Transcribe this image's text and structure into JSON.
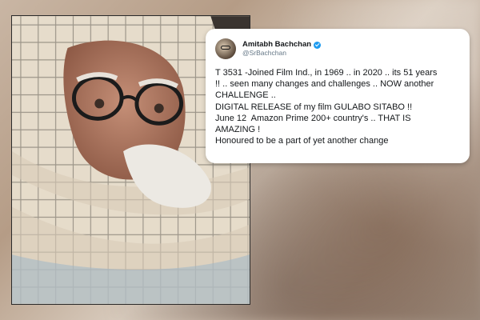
{
  "tweet": {
    "display_name": "Amitabh Bachchan",
    "handle": "@SrBachchan",
    "verified": true,
    "lines": [
      "T 3531 -Joined Film Ind., in 1969 .. in 2020 .. its 51 years",
      "!! .. seen many changes and challenges .. NOW another",
      "CHALLENGE ..",
      "DIGITAL RELEASE of my film GULABO SITABO !!",
      "June 12  Amazon Prime 200+ country's .. THAT IS",
      "AMAZING !",
      "Honoured to be a part of yet another change"
    ]
  },
  "colors": {
    "verified_badge": "#1d9bf0",
    "text": "#14171a",
    "handle": "#657786",
    "card_bg": "#ffffff"
  },
  "photo": {
    "subject": "elderly man with glasses wrapped in checked scarf"
  }
}
